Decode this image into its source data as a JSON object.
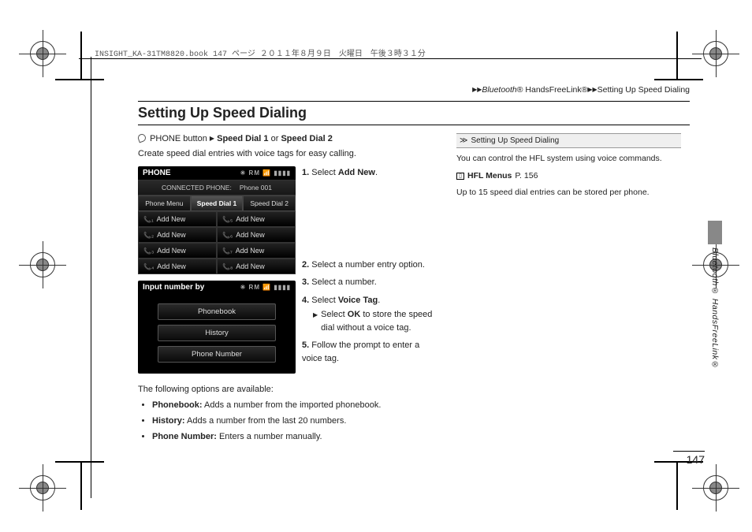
{
  "meta_header": "INSIGHT_KA-31TM8820.book  147 ページ  ２０１１年８月９日　火曜日　午後３時３１分",
  "breadcrumb": {
    "tri": "▶▶",
    "seg1_italic": "Bluetooth",
    "seg1_rest": "® HandsFreeLink®",
    "seg2": "Setting Up Speed Dialing"
  },
  "title": "Setting Up Speed Dialing",
  "nav": {
    "button": "PHONE button",
    "tri": "▶",
    "sd1": "Speed Dial 1",
    "or": "or",
    "sd2": "Speed Dial 2"
  },
  "intro": "Create speed dial entries with voice tags for easy calling.",
  "screen1": {
    "title": "PHONE",
    "icons": "✳ RM 📶 ▮▮▮▮",
    "connected_label": "CONNECTED PHONE:",
    "connected_value": "Phone 001",
    "tabs": [
      "Phone Menu",
      "Speed Dial 1",
      "Speed Dial 2"
    ],
    "cells": [
      "Add New",
      "Add New",
      "Add New",
      "Add New",
      "Add New",
      "Add New",
      "Add New",
      "Add New"
    ],
    "phone_icons": [
      "📞₁",
      "📞₅",
      "📞₂",
      "📞₆",
      "📞₃",
      "📞₇",
      "📞₄",
      "📞₈"
    ]
  },
  "screen2": {
    "title": "Input number by",
    "icons": "✳ RM 📶 ▮▮▮▮",
    "options": [
      "Phonebook",
      "History",
      "Phone Number"
    ]
  },
  "steps": {
    "s1_num": "1.",
    "s1_a": "Select ",
    "s1_b": "Add New",
    "s1_c": ".",
    "s2_num": "2.",
    "s2": "Select a number entry option.",
    "s3_num": "3.",
    "s3": "Select a number.",
    "s4_num": "4.",
    "s4_a": "Select ",
    "s4_b": "Voice Tag",
    "s4_c": ".",
    "s4_sub_tri": "▶",
    "s4_sub_a": "Select ",
    "s4_sub_b": "OK",
    "s4_sub_c": " to store the speed dial without a voice tag.",
    "s5_num": "5.",
    "s5": "Follow the prompt to enter a voice tag."
  },
  "follow": "The following options are available:",
  "opts": {
    "o1_b": "Phonebook:",
    "o1": " Adds a number from the imported phonebook.",
    "o2_b": "History:",
    "o2": " Adds a number from the last 20 numbers.",
    "o3_b": "Phone Number:",
    "o3": " Enters a number manually."
  },
  "sidebar": {
    "head_icon": "≫",
    "head": "Setting Up Speed Dialing",
    "p1": "You can control the HFL system using voice commands.",
    "ref_icon": "▯",
    "ref_b": "HFL Menus",
    "ref_p": "P. 156",
    "p2": "Up to 15 speed dial entries can be stored per phone."
  },
  "side_tab_italic": "Bluetooth",
  "side_tab_rest": "® HandsFreeLink®",
  "page_number": "147"
}
